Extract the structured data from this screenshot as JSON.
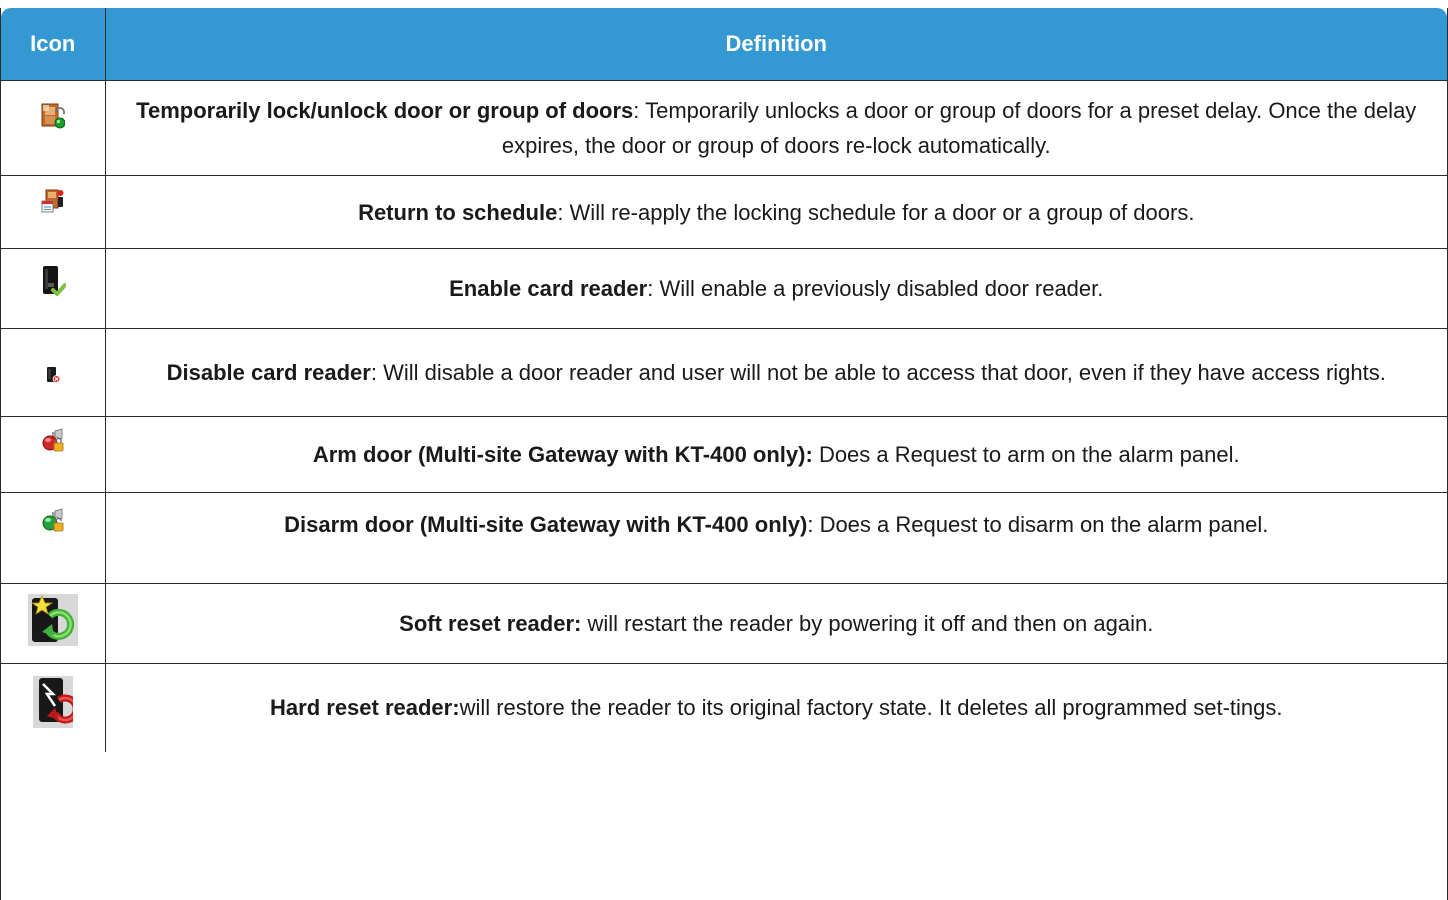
{
  "table": {
    "headers": {
      "icon": "Icon",
      "definition": "Definition"
    },
    "rows": [
      {
        "icon": "temporarily-unlock-door-icon",
        "title": "Temporarily lock/unlock door or group of doors",
        "sep": ": ",
        "text": "Temporarily unlocks a door or group of doors for a preset delay. Once the delay expires, the door or group of doors re-lock automatically."
      },
      {
        "icon": "return-to-schedule-icon",
        "title": "Return to schedule",
        "sep": ": ",
        "text": "Will re-apply the locking schedule for a door or a group of doors."
      },
      {
        "icon": "enable-card-reader-icon",
        "title": "Enable card reader",
        "sep": ": ",
        "text": "Will enable a previously disabled door reader."
      },
      {
        "icon": "disable-card-reader-icon",
        "title": "Disable card reader",
        "sep": ": ",
        "text": "Will disable a door reader and user will not be able to access that door, even if they have access rights."
      },
      {
        "icon": "arm-door-icon",
        "title": "Arm door (Multi-site Gateway with KT-400 only):",
        "sep": " ",
        "text": "Does a Request to arm on the alarm panel."
      },
      {
        "icon": "disarm-door-icon",
        "title": "Disarm door (Multi-site Gateway with KT-400 only)",
        "sep": ": ",
        "text": "Does a Request to disarm on the alarm panel."
      },
      {
        "icon": "soft-reset-reader-icon",
        "title": "Soft reset reader:",
        "sep": " ",
        "text": "will restart the reader by powering it off and then on again."
      },
      {
        "icon": "hard-reset-reader-icon",
        "title": "Hard reset reader:",
        "sep": "",
        "text": "will restore the reader to its original factory state. It deletes all programmed set-tings."
      }
    ]
  }
}
